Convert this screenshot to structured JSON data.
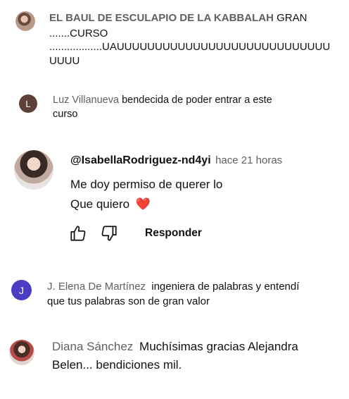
{
  "comments": [
    {
      "author": "EL BAUL DE ESCULAPIO DE LA KABBALAH",
      "lines": [
        "GRAN",
        ".......CURSO",
        "..................UAUUUUUUUUUUUUUUUUUUUUUUUUUUUU",
        "UUUU"
      ]
    },
    {
      "author": "Luz Villanueva",
      "avatar_letter": "L",
      "avatar_color": "#5d4037",
      "lines": [
        "bendecida de poder entrar a este",
        "curso"
      ]
    },
    {
      "author": "@IsabellaRodriguez-nd4yi",
      "time": "hace 21 horas",
      "lines": [
        "Me doy permiso de querer lo",
        "Que quiero"
      ],
      "emoji": "❤️",
      "reply_label": "Responder"
    },
    {
      "author": "J. Elena De Martínez",
      "avatar_letter": "J",
      "avatar_color": "#4b3cc4",
      "lines": [
        "ingeniera de palabras y entendí",
        "que tus palabras son de gran valor"
      ]
    },
    {
      "author": "Diana Sánchez",
      "lines": [
        "Muchísimas gracias Alejandra",
        "Belen... bendiciones mil."
      ]
    }
  ],
  "icons": {
    "like": "thumbs-up-icon",
    "dislike": "thumbs-down-icon"
  }
}
